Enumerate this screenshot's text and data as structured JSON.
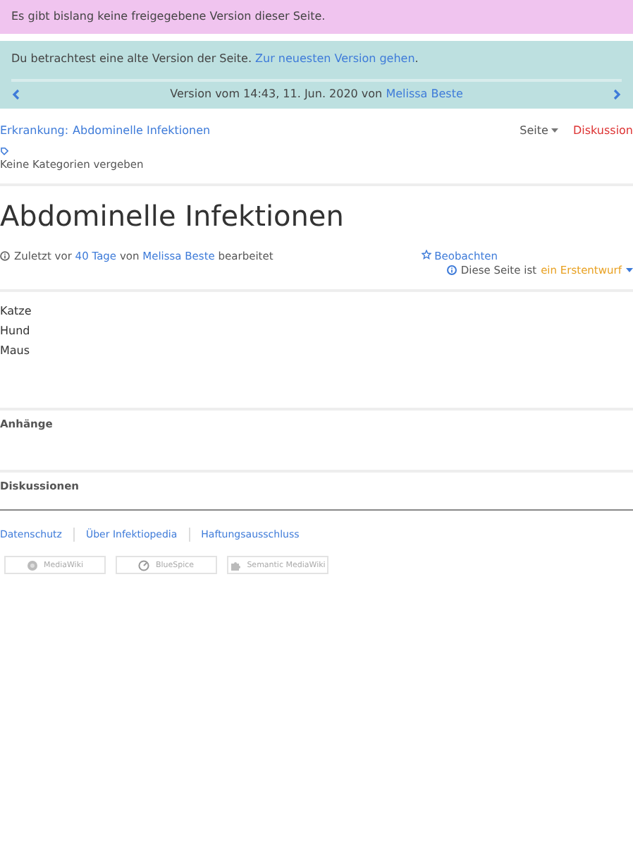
{
  "notice": {
    "text": "Es gibt bislang keine freigegebene Version dieser Seite."
  },
  "old_version": {
    "text": "Du betrachtest eine alte Version der Seite.",
    "link": "Zur neuesten Version gehen",
    "suffix": ".",
    "version_text": "Version vom 14:43, 11. Jun. 2020 von",
    "version_author": "Melissa Beste"
  },
  "breadcrumb": {
    "label": "Erkrankung:",
    "link": "Abdominelle Infektionen"
  },
  "page_tabs": [
    {
      "label": "Seite",
      "kind": "dropdown"
    },
    {
      "label": "Diskussion",
      "kind": "new"
    }
  ],
  "categories": {
    "text": "Keine Kategorien vergeben"
  },
  "title": "Abdominelle Infektionen",
  "meta": {
    "prefix": "Zuletzt vor",
    "age": "40 Tage",
    "middle": "von",
    "author": "Melissa Beste",
    "suffix": "bearbeitet",
    "watch": "Beobachten",
    "status_prefix": "Diese Seite ist",
    "status": "ein Erstentwurf"
  },
  "content": [
    "Katze",
    "Hund",
    "Maus"
  ],
  "sections": [
    "Anhänge",
    "Diskussionen"
  ],
  "footer_links": [
    "Datenschutz",
    "Über Infektiopedia",
    "Haftungsausschluss"
  ],
  "badges": [
    {
      "label": "MediaWiki",
      "kind": "mediawiki"
    },
    {
      "label": "BlueSpice",
      "kind": "bluespice"
    },
    {
      "label": "Semantic MediaWiki",
      "kind": "smw"
    }
  ]
}
